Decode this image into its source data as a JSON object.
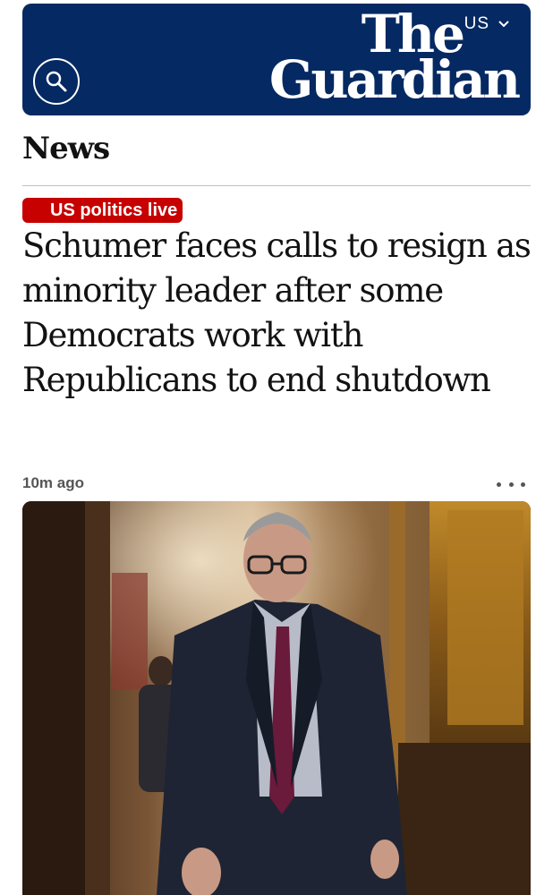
{
  "header": {
    "edition_label": "US",
    "logo_line1": "The",
    "logo_line2": "Guardian",
    "search_icon": "search-icon",
    "chevron_icon": "chevron-down-icon"
  },
  "section": {
    "title": "News"
  },
  "article": {
    "kicker": "US politics live",
    "headline": "Schumer faces calls to resign as minority leader after some Democrats work with Republicans to end shutdown",
    "timestamp": "10m ago",
    "more_icon": "more-options-icon"
  },
  "colors": {
    "brand_blue": "#052962",
    "live_red": "#c70000",
    "text": "#121212",
    "meta_gray": "#555555"
  }
}
